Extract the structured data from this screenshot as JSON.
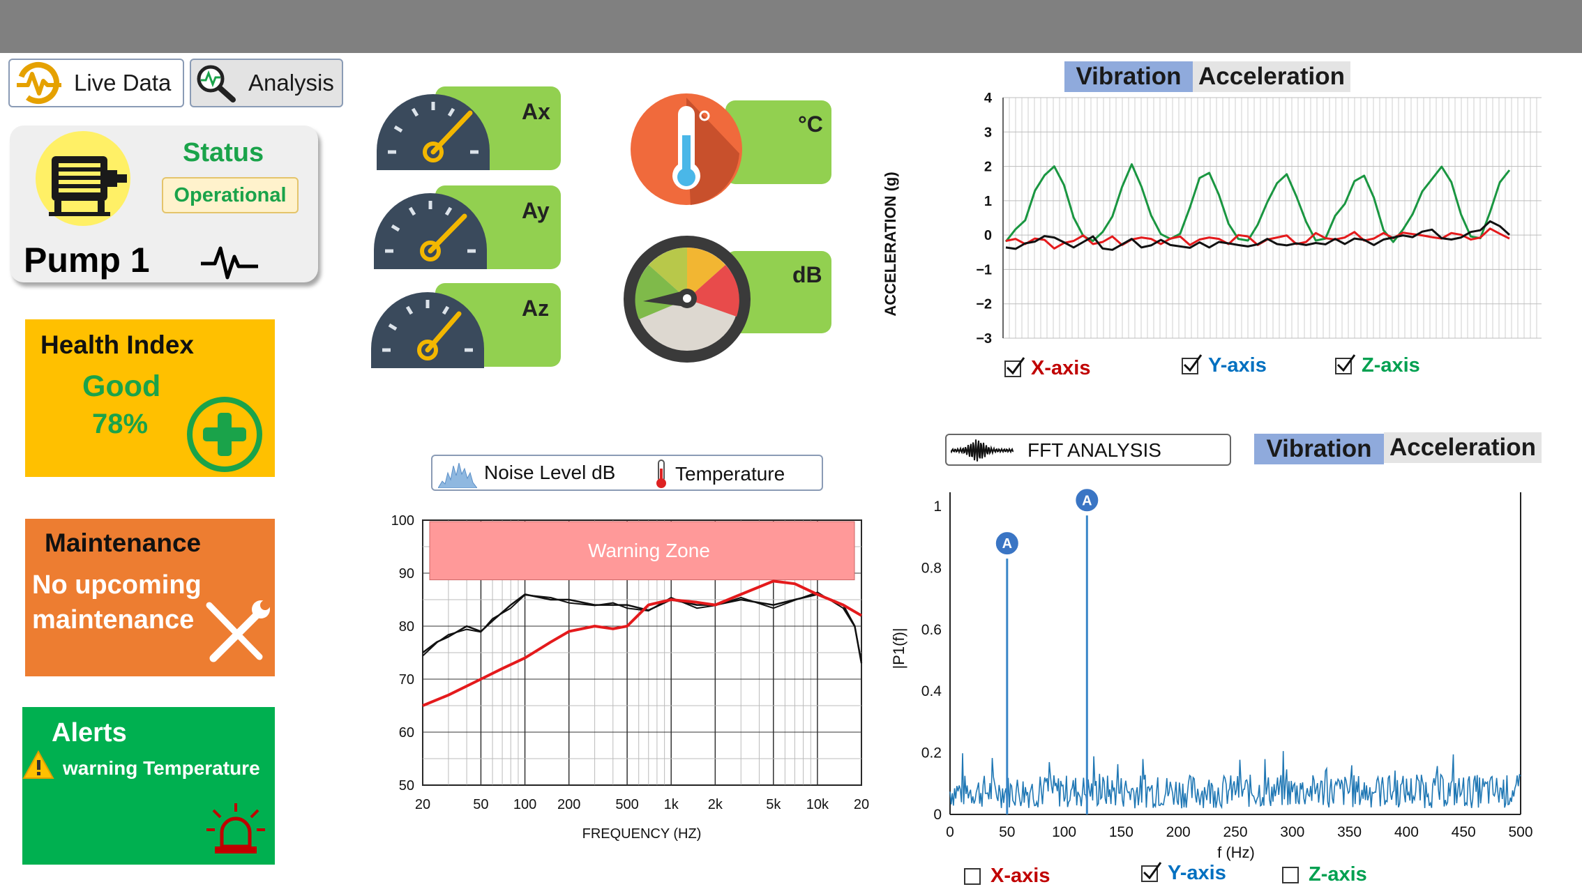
{
  "nav": {
    "live_data": "Live Data",
    "analysis": "Analysis"
  },
  "pump": {
    "status_title": "Status",
    "status_value": "Operational",
    "name": "Pump 1"
  },
  "health": {
    "title": "Health Index",
    "state": "Good",
    "percent": "78%"
  },
  "maintenance": {
    "title": "Maintenance",
    "line1": "No upcoming",
    "line2": "maintenance"
  },
  "alerts": {
    "title": "Alerts",
    "message": "warning Temperature"
  },
  "gauges": {
    "ax": "Ax",
    "ay": "Ay",
    "az": "Az",
    "temp_unit": "°C",
    "noise_unit": "dB"
  },
  "colors": {
    "green_box": "#92d050",
    "health": "#ffc000",
    "maintenance": "#ed7d31",
    "alerts": "#00b050",
    "tab_active": "#8faadc"
  },
  "vibration_chart": {
    "tabs": [
      "Vibration",
      "Acceleration"
    ],
    "checkboxes": [
      {
        "label": "X-axis",
        "checked": true,
        "color": "#c00000"
      },
      {
        "label": "Y-axis",
        "checked": true,
        "color": "#0070c0"
      },
      {
        "label": "Z-axis",
        "checked": true,
        "color": "#00a050"
      }
    ]
  },
  "noise_legend": {
    "noise": "Noise Level dB",
    "temperature": "Temperature"
  },
  "fft": {
    "button": "FFT ANALYSIS",
    "tabs": [
      "Vibration",
      "Acceleration"
    ],
    "checkboxes": [
      {
        "label": "X-axis",
        "checked": false,
        "color": "#c00000"
      },
      {
        "label": "Y-axis",
        "checked": true,
        "color": "#0070c0"
      },
      {
        "label": "Z-axis",
        "checked": false,
        "color": "#00a050"
      }
    ]
  },
  "chart_data": [
    {
      "type": "line",
      "title": "",
      "ylabel": "ACCELERATION (g)",
      "xlabel": "",
      "ylim": [
        -3,
        4
      ],
      "yticks": [
        "4",
        "3",
        "2",
        "1",
        "0",
        "−1",
        "−2",
        "−3"
      ],
      "grid": true,
      "series": [
        {
          "color": "#1a9641",
          "values": [
            -0.1,
            0.2,
            0.4,
            1.2,
            1.8,
            2.0,
            1.4,
            0.6,
            0.0,
            -0.2,
            0.0,
            0.6,
            1.4,
            2.0,
            1.5,
            0.6,
            0.0,
            -0.2,
            0.1,
            0.8,
            1.6,
            1.9,
            1.2,
            0.3,
            -0.2,
            -0.1,
            0.3,
            0.9,
            1.6,
            1.8,
            1.1,
            0.3,
            -0.1,
            -0.1,
            0.5,
            1.0,
            1.6,
            1.7,
            1.0,
            0.2,
            -0.2,
            0.1,
            0.7,
            1.3,
            1.6,
            1.9,
            1.6,
            0.6,
            -0.1,
            0.0,
            0.7,
            1.5,
            1.8
          ]
        },
        {
          "color": "#e41a1c",
          "values": [
            -0.2,
            -0.2,
            -0.2,
            -0.1,
            -0.2,
            -0.3,
            -0.2,
            -0.2,
            -0.1,
            -0.2,
            -0.2,
            -0.1,
            -0.2,
            -0.1,
            -0.1,
            -0.2,
            -0.2,
            -0.1,
            -0.1,
            -0.2,
            -0.1,
            -0.1,
            -0.2,
            -0.2,
            0.0,
            -0.1,
            -0.2,
            -0.1,
            -0.1,
            -0.1,
            -0.2,
            -0.2,
            0.0,
            0.0,
            -0.1,
            -0.1,
            0.0,
            -0.1,
            -0.1,
            0.0,
            0.0,
            0.1,
            0.0,
            -0.1,
            0.0,
            -0.1,
            0.0,
            0.1,
            -0.1,
            -0.1,
            0.1,
            0.1,
            -0.1
          ]
        },
        {
          "color": "#111111",
          "values": [
            -0.3,
            -0.4,
            -0.3,
            -0.1,
            0.0,
            -0.1,
            -0.3,
            -0.3,
            -0.2,
            -0.1,
            -0.3,
            -0.4,
            -0.3,
            -0.2,
            -0.3,
            -0.3,
            -0.2,
            -0.2,
            -0.3,
            -0.4,
            -0.3,
            -0.3,
            -0.2,
            -0.3,
            -0.2,
            -0.3,
            -0.3,
            -0.2,
            -0.2,
            -0.3,
            -0.3,
            -0.2,
            -0.2,
            -0.3,
            -0.2,
            -0.2,
            -0.1,
            -0.2,
            -0.2,
            -0.1,
            -0.1,
            -0.1,
            0.0,
            0.1,
            0.1,
            0.0,
            -0.1,
            -0.1,
            0.0,
            0.2,
            0.4,
            0.2,
            0.1
          ]
        }
      ]
    },
    {
      "type": "line",
      "title": "",
      "xlabel": "FREQUENCY  (HZ)",
      "ylabel": "",
      "ylim": [
        50,
        100
      ],
      "x_scale": "log",
      "xticks": [
        "20",
        "50",
        "100",
        "200",
        "500",
        "1k",
        "2k",
        "5k",
        "10k",
        "20"
      ],
      "yticks": [
        "100",
        "90",
        "80",
        "70",
        "60",
        "50"
      ],
      "annotation": {
        "label": "Warning  Zone",
        "y_from": 89,
        "y_to": 100,
        "color": "#ff9999"
      },
      "series": [
        {
          "color": "#111111",
          "x": [
            20,
            25,
            30,
            40,
            50,
            60,
            80,
            100,
            150,
            200,
            300,
            400,
            500,
            700,
            1000,
            1500,
            2000,
            3000,
            5000,
            7000,
            10000,
            15000,
            18000,
            20000
          ],
          "values": [
            75,
            77,
            78,
            80,
            79,
            81,
            84,
            86,
            85,
            85,
            84,
            84,
            84,
            83,
            85,
            84,
            84,
            85,
            84,
            85,
            86,
            84,
            80,
            73
          ]
        },
        {
          "color": "#e41a1c",
          "x": [
            20,
            30,
            50,
            70,
            100,
            150,
            200,
            300,
            400,
            500,
            700,
            1000,
            1500,
            2000,
            3000,
            5000,
            7000,
            10000,
            15000,
            20000
          ],
          "values": [
            65,
            67,
            70,
            72,
            74,
            77,
            79,
            80,
            79.5,
            80,
            84,
            85,
            84.5,
            84,
            86,
            88.5,
            88,
            86,
            84,
            82
          ]
        }
      ]
    },
    {
      "type": "line",
      "title": "",
      "xlabel": "f (Hz)",
      "ylabel": "|P1(f)|",
      "xlim": [
        0,
        500
      ],
      "ylim": [
        0,
        1
      ],
      "xticks": [
        "0",
        "50",
        "100",
        "150",
        "200",
        "250",
        "300",
        "350",
        "400",
        "450",
        "500"
      ],
      "yticks": [
        "1",
        "0.8",
        "0.6",
        "0.4",
        "0.2",
        "0"
      ],
      "peaks": [
        {
          "x": 50,
          "y": 0.83,
          "label": "A"
        },
        {
          "x": 120,
          "y": 0.97,
          "label": "A"
        }
      ],
      "series": [
        {
          "color": "#1f77b4",
          "noise_level": 0.1
        }
      ]
    }
  ]
}
